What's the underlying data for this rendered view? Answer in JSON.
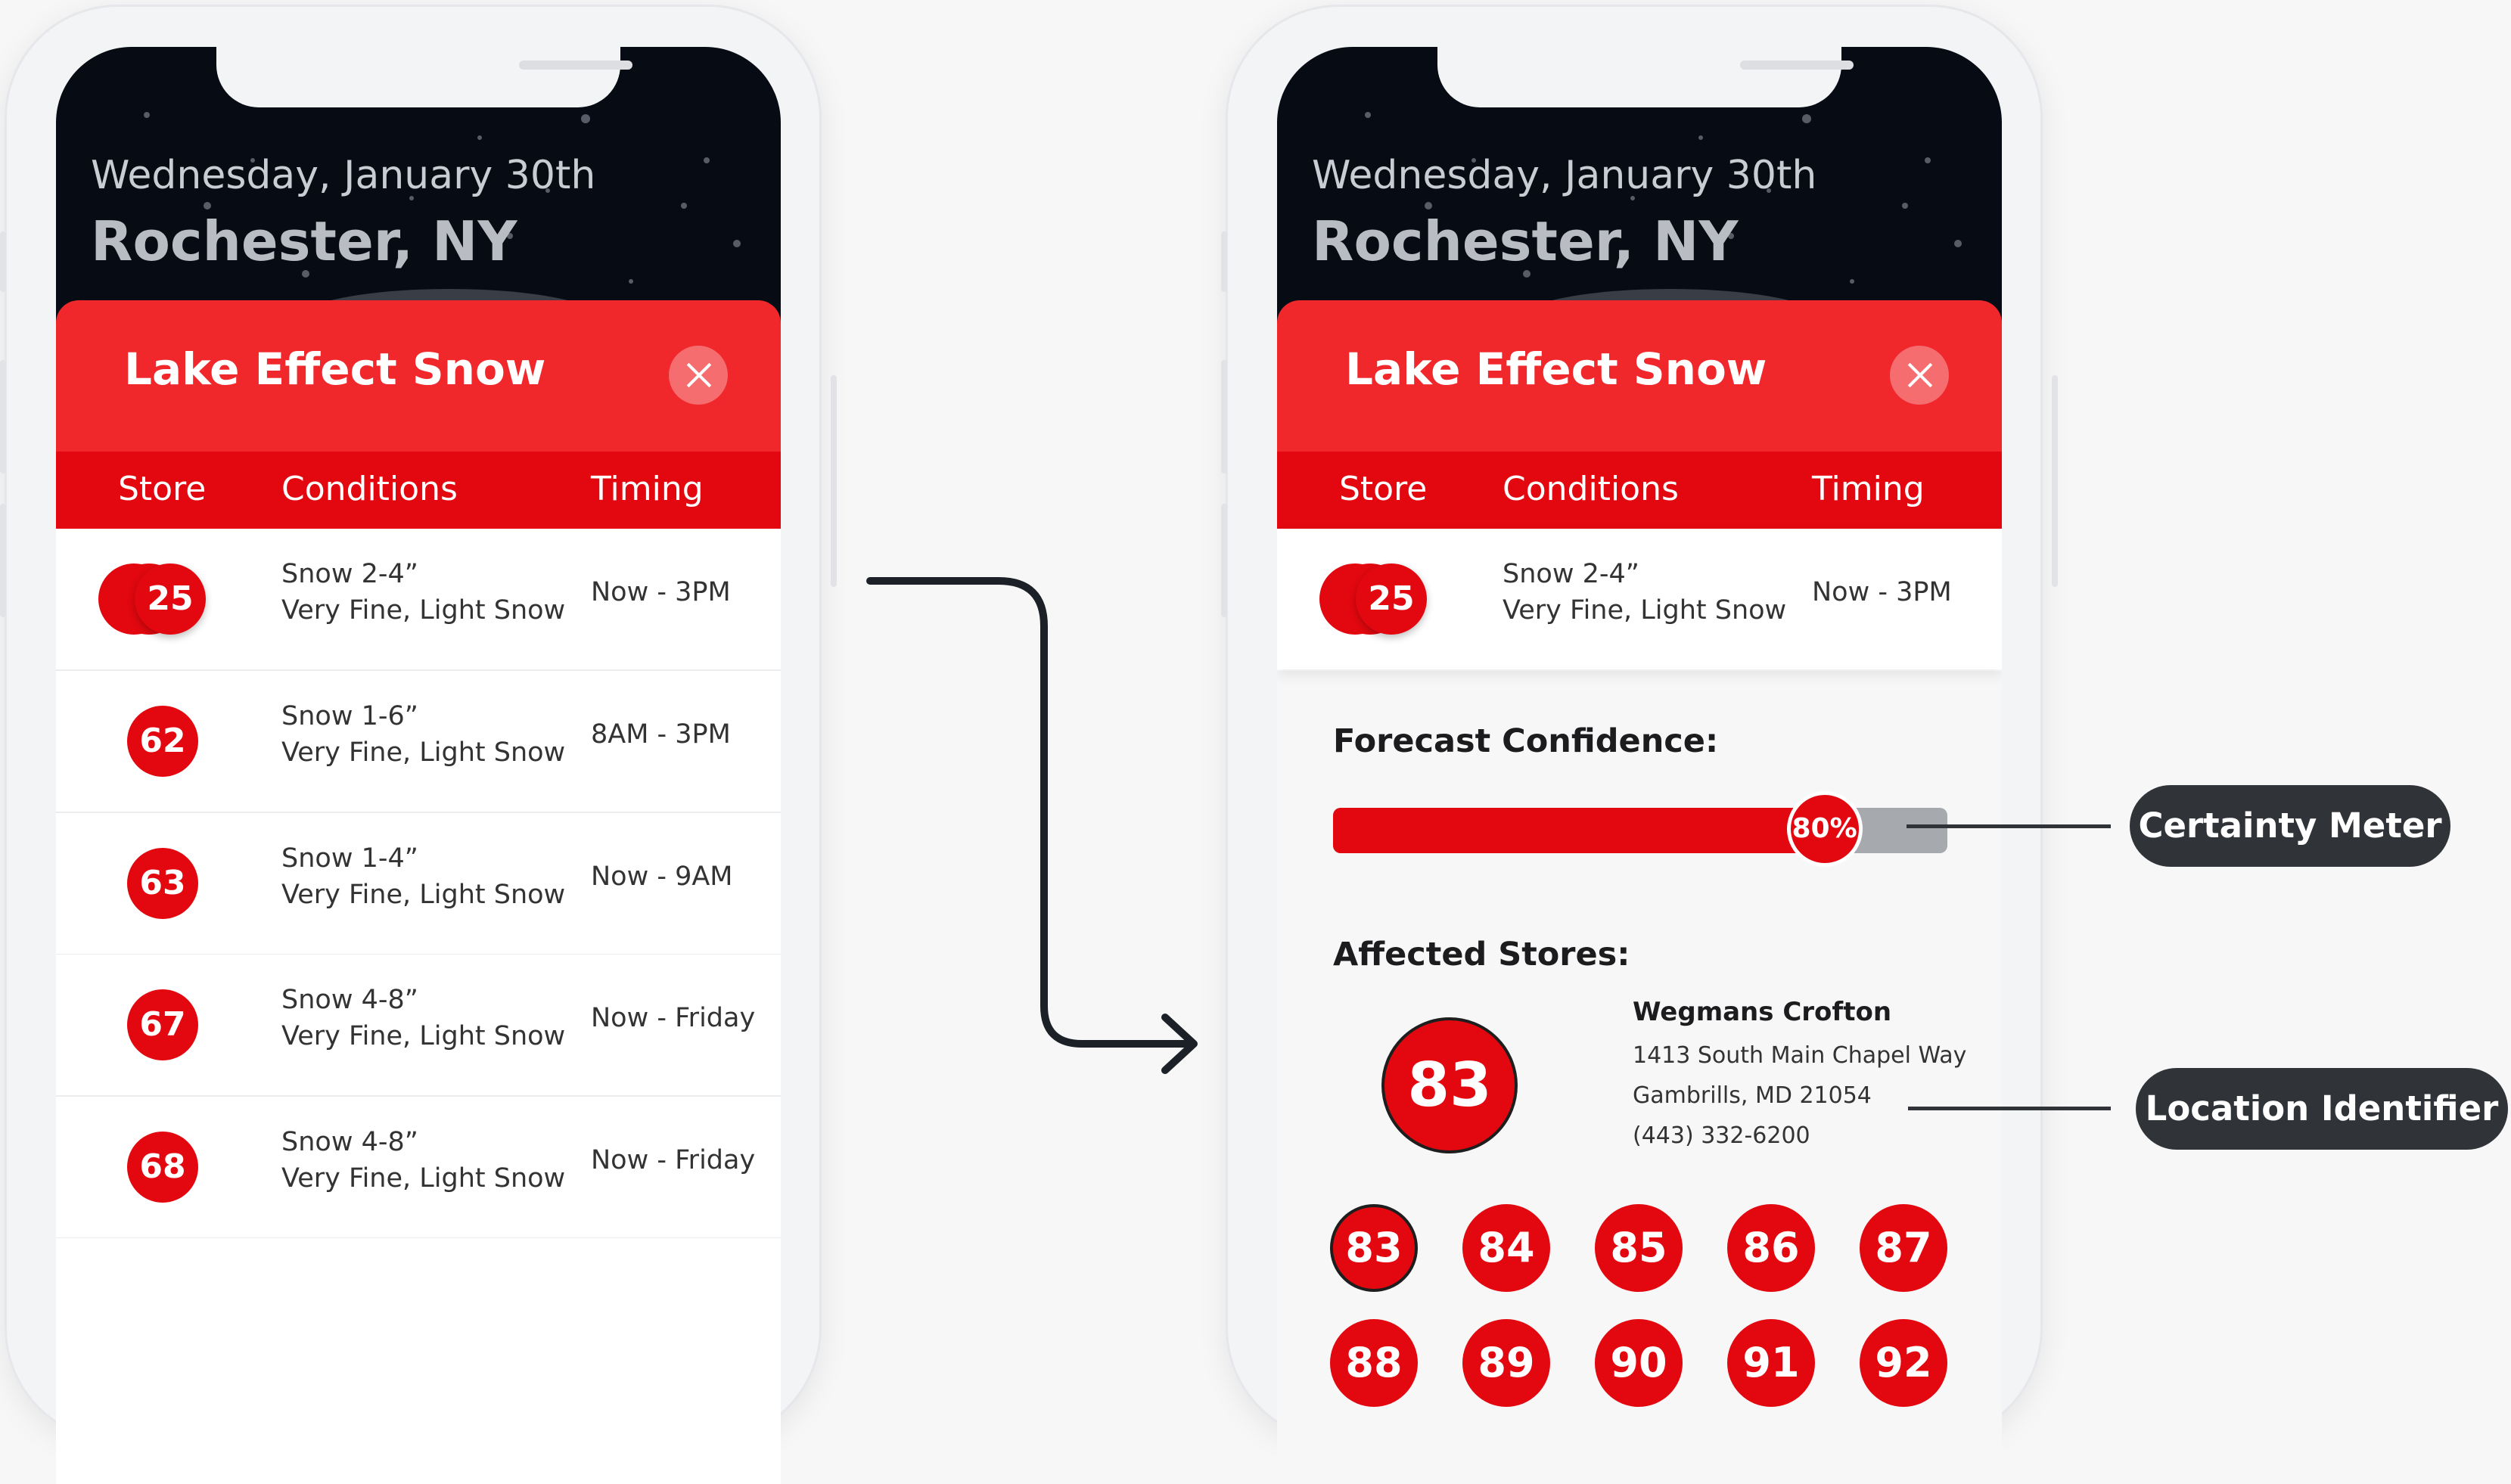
{
  "header": {
    "date": "Wednesday, January 30th",
    "city": "Rochester, NY"
  },
  "alert": {
    "title": "Lake Effect Snow",
    "close_icon": "close-icon"
  },
  "columns": [
    "Store",
    "Conditions",
    "Timing"
  ],
  "rows": [
    {
      "store": "25",
      "stacked": [
        "1",
        "1"
      ],
      "conditions": "Snow 2-4”",
      "detail": "Very Fine, Light Snow",
      "timing": "Now - 3PM"
    },
    {
      "store": "62",
      "conditions": "Snow 1-6”",
      "detail": "Very Fine, Light Snow",
      "timing": "8AM - 3PM"
    },
    {
      "store": "63",
      "conditions": "Snow 1-4”",
      "detail": "Very Fine, Light Snow",
      "timing": "Now - 9AM"
    },
    {
      "store": "67",
      "conditions": "Snow 4-8”",
      "detail": "Very Fine, Light Snow",
      "timing": "Now - Friday"
    },
    {
      "store": "68",
      "conditions": "Snow 4-8”",
      "detail": "Very Fine, Light Snow",
      "timing": "Now - Friday"
    }
  ],
  "details": {
    "confidence_label": "Forecast Confidence:",
    "confidence_value": "80%",
    "confidence_fraction": 0.8,
    "affected_label": "Affected Stores:",
    "selected_store": {
      "number": "83",
      "name": "Wegmans Crofton",
      "address": "1413 South Main Chapel Way",
      "city": "Gambrills, MD 21054",
      "phone": "(443) 332-6200"
    },
    "stores": [
      "83",
      "84",
      "85",
      "86",
      "87",
      "88",
      "89",
      "90",
      "91",
      "92"
    ]
  },
  "callouts": {
    "meter": "Certainty Meter",
    "location": "Location Identifier"
  },
  "colors": {
    "brand_red": "#e3080f",
    "header_red": "#f0282b",
    "callout_dark": "#303338",
    "arrow": "#1c2128"
  }
}
